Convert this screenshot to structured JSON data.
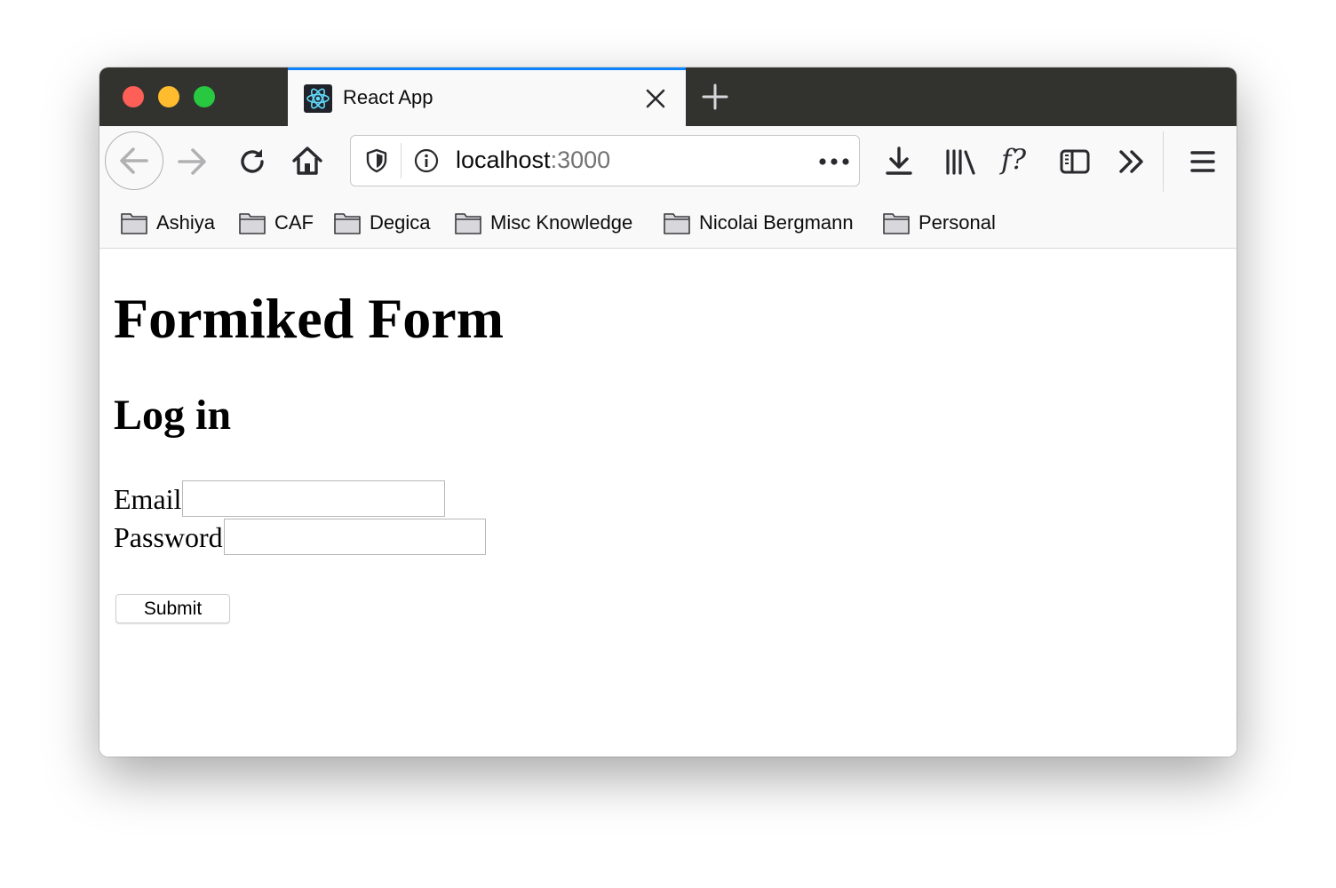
{
  "browser": {
    "tab": {
      "title": "React App",
      "favicon": "react-logo-icon"
    },
    "url": {
      "host": "localhost",
      "port": ":3000"
    },
    "accent_color": "#0a84ff",
    "bookmarks": [
      {
        "label": "Ashiya",
        "icon": "folder-icon"
      },
      {
        "label": "CAF",
        "icon": "folder-icon"
      },
      {
        "label": "Degica",
        "icon": "folder-icon"
      },
      {
        "label": "Misc Knowledge",
        "icon": "folder-icon"
      },
      {
        "label": "Nicolai Bergmann",
        "icon": "folder-icon"
      },
      {
        "label": "Personal",
        "icon": "folder-icon"
      }
    ]
  },
  "page": {
    "title": "Formiked Form",
    "subtitle": "Log in",
    "email": {
      "label": "Email",
      "value": ""
    },
    "password": {
      "label": "Password",
      "value": ""
    },
    "submit_label": "Submit"
  }
}
